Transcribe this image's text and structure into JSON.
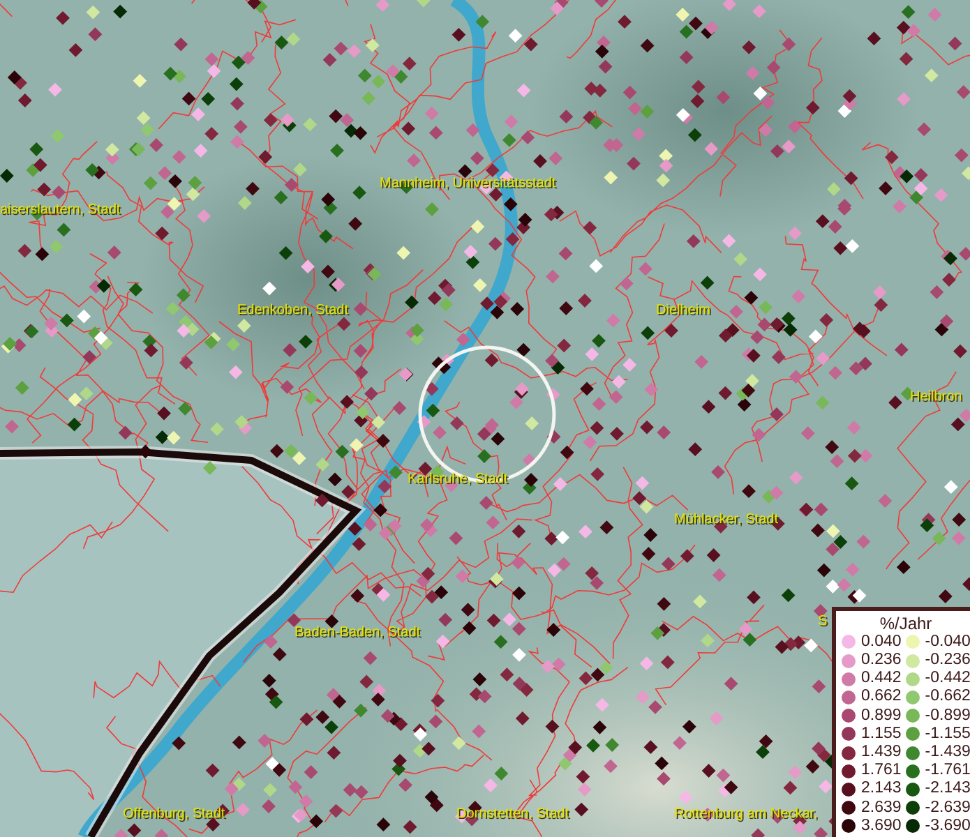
{
  "map": {
    "labels": [
      {
        "text": "Mannheim, Universitätsstadt"
      },
      {
        "text": "aiserslautern, Stadt"
      },
      {
        "text": "Edenkoben, Stadt"
      },
      {
        "text": "Dielheim"
      },
      {
        "text": "Heilbron"
      },
      {
        "text": "Karlsruhe, Stadt"
      },
      {
        "text": "Mühlacker, Stadt"
      },
      {
        "text": "Baden-Baden, Stadt"
      },
      {
        "text": "S"
      },
      {
        "text": "Offenburg, Stadt"
      },
      {
        "text": "Dornstetten, Stadt"
      },
      {
        "text": "Rottenburg am Neckar,"
      }
    ]
  },
  "legend": {
    "title": "%/Jahr",
    "positive": [
      {
        "label": "0.040",
        "color": "#f5b8e6"
      },
      {
        "label": "0.236",
        "color": "#e59ac8"
      },
      {
        "label": "0.442",
        "color": "#d07aa8"
      },
      {
        "label": "0.662",
        "color": "#c06690"
      },
      {
        "label": "0.899",
        "color": "#a84a70"
      },
      {
        "label": "1.155",
        "color": "#94385a"
      },
      {
        "label": "1.439",
        "color": "#84283f"
      },
      {
        "label": "1.761",
        "color": "#701a30"
      },
      {
        "label": "2.143",
        "color": "#581020"
      },
      {
        "label": "2.639",
        "color": "#400810"
      },
      {
        "label": "3.690",
        "color": "#2a0408"
      }
    ],
    "negative": [
      {
        "label": "-0.040",
        "color": "#eef5b0"
      },
      {
        "label": "-0.236",
        "color": "#d0e8a0"
      },
      {
        "label": "-0.442",
        "color": "#b0d888"
      },
      {
        "label": "-0.662",
        "color": "#90c870"
      },
      {
        "label": "-0.899",
        "color": "#78b858"
      },
      {
        "label": "-1.155",
        "color": "#5ca040"
      },
      {
        "label": "-1.439",
        "color": "#408830"
      },
      {
        "label": "-1.761",
        "color": "#287020"
      },
      {
        "label": "-2.143",
        "color": "#185810"
      },
      {
        "label": "-2.639",
        "color": "#0c4008"
      },
      {
        "label": "-3.690",
        "color": "#062a04"
      }
    ]
  }
}
